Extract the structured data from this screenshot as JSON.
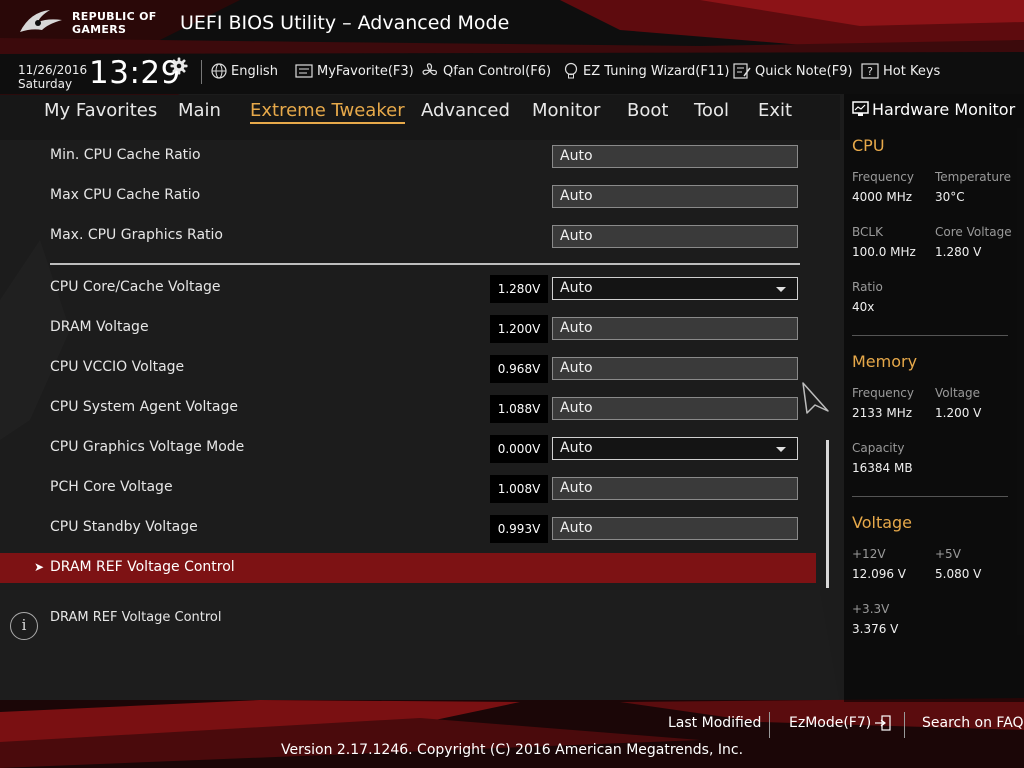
{
  "header": {
    "brand_line1": "REPUBLIC OF",
    "brand_line2": "GAMERS",
    "title": "UEFI BIOS Utility – Advanced Mode"
  },
  "datetime": {
    "date": "11/26/2016",
    "day": "Saturday",
    "time": "13:29"
  },
  "toolbar": {
    "language": "English",
    "myfavorite": "MyFavorite(F3)",
    "qfan": "Qfan Control(F6)",
    "ez_tuning": "EZ Tuning Wizard(F11)",
    "quick_note": "Quick Note(F9)",
    "hot_keys": "Hot Keys"
  },
  "menu": {
    "items": [
      "My Favorites",
      "Main",
      "Extreme Tweaker",
      "Advanced",
      "Monitor",
      "Boot",
      "Tool",
      "Exit"
    ],
    "active": "Extreme Tweaker"
  },
  "settings": [
    {
      "label": "Min. CPU Cache Ratio",
      "value": "Auto",
      "voltage": "",
      "dropdown": false
    },
    {
      "label": "Max CPU Cache Ratio",
      "value": "Auto",
      "voltage": "",
      "dropdown": false
    },
    {
      "label": "Max. CPU Graphics Ratio",
      "value": "Auto",
      "voltage": "",
      "dropdown": false
    },
    {
      "label": "CPU Core/Cache Voltage",
      "value": "Auto",
      "voltage": "1.280V",
      "dropdown": true
    },
    {
      "label": "DRAM Voltage",
      "value": "Auto",
      "voltage": "1.200V",
      "dropdown": false
    },
    {
      "label": "CPU VCCIO Voltage",
      "value": "Auto",
      "voltage": "0.968V",
      "dropdown": false
    },
    {
      "label": "CPU System Agent Voltage",
      "value": "Auto",
      "voltage": "1.088V",
      "dropdown": false
    },
    {
      "label": "CPU Graphics Voltage Mode",
      "value": "Auto",
      "voltage": "0.000V",
      "dropdown": true
    },
    {
      "label": "PCH Core Voltage",
      "value": "Auto",
      "voltage": "1.008V",
      "dropdown": false
    },
    {
      "label": "CPU Standby Voltage",
      "value": "Auto",
      "voltage": "0.993V",
      "dropdown": false
    }
  ],
  "submenu": {
    "chevron": "➤",
    "label": "DRAM REF Voltage Control"
  },
  "help": {
    "icon": "i",
    "text": "DRAM REF Voltage Control"
  },
  "hardware_monitor": {
    "title": "Hardware Monitor",
    "cpu": {
      "heading": "CPU",
      "frequency_label": "Frequency",
      "frequency": "4000 MHz",
      "temperature_label": "Temperature",
      "temperature": "30°C",
      "bclk_label": "BCLK",
      "bclk": "100.0 MHz",
      "core_voltage_label": "Core Voltage",
      "core_voltage": "1.280 V",
      "ratio_label": "Ratio",
      "ratio": "40x"
    },
    "memory": {
      "heading": "Memory",
      "frequency_label": "Frequency",
      "frequency": "2133 MHz",
      "voltage_label": "Voltage",
      "voltage": "1.200 V",
      "capacity_label": "Capacity",
      "capacity": "16384 MB"
    },
    "voltage": {
      "heading": "Voltage",
      "v12_label": "+12V",
      "v12": "12.096 V",
      "v5_label": "+5V",
      "v5": "5.080 V",
      "v33_label": "+3.3V",
      "v33": "3.376 V"
    }
  },
  "footer": {
    "last_modified": "Last Modified",
    "ezmode": "EzMode(F7)",
    "search_faq": "Search on FAQ",
    "copyright": "Version 2.17.1246. Copyright (C) 2016 American Megatrends, Inc."
  },
  "colors": {
    "accent": "#e7a94a",
    "selection": "#7d1214",
    "brand_red": "#b0161c"
  }
}
